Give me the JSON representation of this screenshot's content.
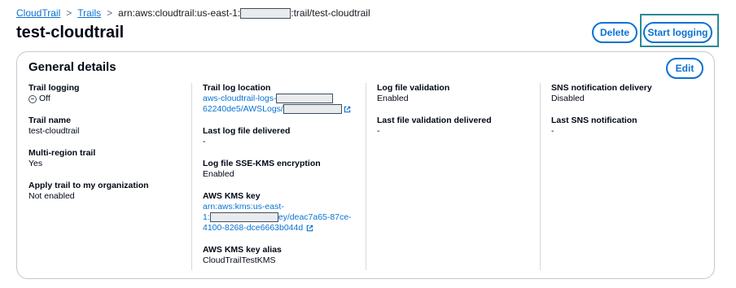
{
  "breadcrumb": {
    "root": "CloudTrail",
    "trails": "Trails",
    "current_prefix": "arn:aws:cloudtrail:us-east-1:",
    "current_suffix": ":trail/test-cloudtrail"
  },
  "page": {
    "title": "test-cloudtrail",
    "delete_label": "Delete",
    "start_logging_label": "Start logging"
  },
  "general": {
    "title": "General details",
    "edit_label": "Edit",
    "trail_logging_label": "Trail logging",
    "trail_logging_value": "Off",
    "trail_name_label": "Trail name",
    "trail_name_value": "test-cloudtrail",
    "multi_region_label": "Multi-region trail",
    "multi_region_value": "Yes",
    "apply_org_label": "Apply trail to my organization",
    "apply_org_value": "Not enabled",
    "log_location_label": "Trail log location",
    "log_location_line1": "aws-cloudtrail-logs-",
    "log_location_line2": "62240de5/AWSLogs/",
    "last_delivered_label": "Last log file delivered",
    "last_delivered_value": "-",
    "sse_label": "Log file SSE-KMS encryption",
    "sse_value": "Enabled",
    "kms_key_label": "AWS KMS key",
    "kms_key_line1": "arn:aws:kms:us-east-",
    "kms_key_line2_prefix": "1:",
    "kms_key_line2_suffix": "ey/deac7a65-87ce-",
    "kms_key_line3": "4100-8268-dce6663b044d",
    "kms_alias_label": "AWS KMS key alias",
    "kms_alias_value": "CloudTrailTestKMS",
    "validation_label": "Log file validation",
    "validation_value": "Enabled",
    "last_validation_label": "Last file validation delivered",
    "last_validation_value": "-",
    "sns_label": "SNS notification delivery",
    "sns_value": "Disabled",
    "last_sns_label": "Last SNS notification",
    "last_sns_value": "-"
  }
}
